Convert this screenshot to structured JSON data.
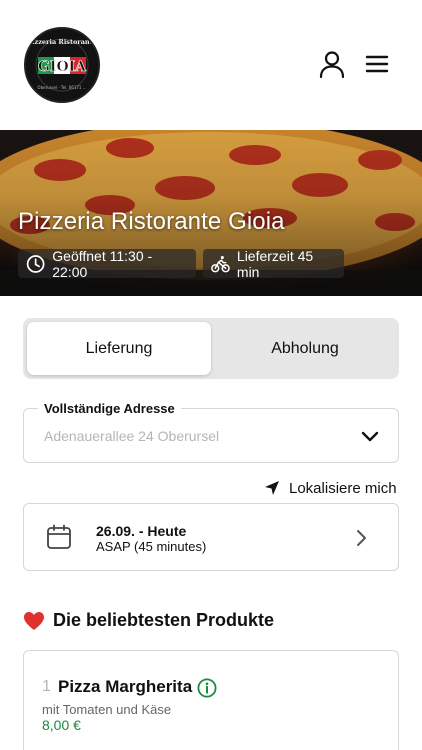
{
  "header": {
    "logo": {
      "name": "Pizzeria Ristorante",
      "brand": "GIOIA",
      "footer": "Oberursel · Tel. 06171 ..."
    }
  },
  "hero": {
    "title": "Pizzeria Ristorante Gioia",
    "opening_label": "Geöffnet 11:30 - 22:00",
    "delivery_label": "Lieferzeit 45 min"
  },
  "order_mode": {
    "options": [
      {
        "label": "Lieferung",
        "selected": true
      },
      {
        "label": "Abholung",
        "selected": false
      }
    ]
  },
  "address": {
    "label": "Vollständige Adresse",
    "placeholder": "Adenauerallee 24 Oberursel",
    "value": ""
  },
  "locate": {
    "label": "Lokalisiere mich"
  },
  "schedule": {
    "date": "26.09. - Heute",
    "time": "ASAP (45 minutes)"
  },
  "popular": {
    "title": "Die beliebtesten Produkte",
    "products": [
      {
        "number": "1",
        "name": "Pizza Margherita",
        "description": "mit Tomaten und Käse",
        "price": "8,00 €"
      }
    ]
  },
  "colors": {
    "price_green": "#1a8a3f",
    "heart_red": "#e0322d",
    "toggle_bg": "#e6e6e6",
    "border": "#d6d6d6"
  },
  "icons": [
    "user-icon",
    "menu-icon",
    "clock-icon",
    "bicycle-icon",
    "chevron-down-icon",
    "navigation-arrow-icon",
    "calendar-icon",
    "chevron-right-icon",
    "heart-icon",
    "info-icon"
  ]
}
